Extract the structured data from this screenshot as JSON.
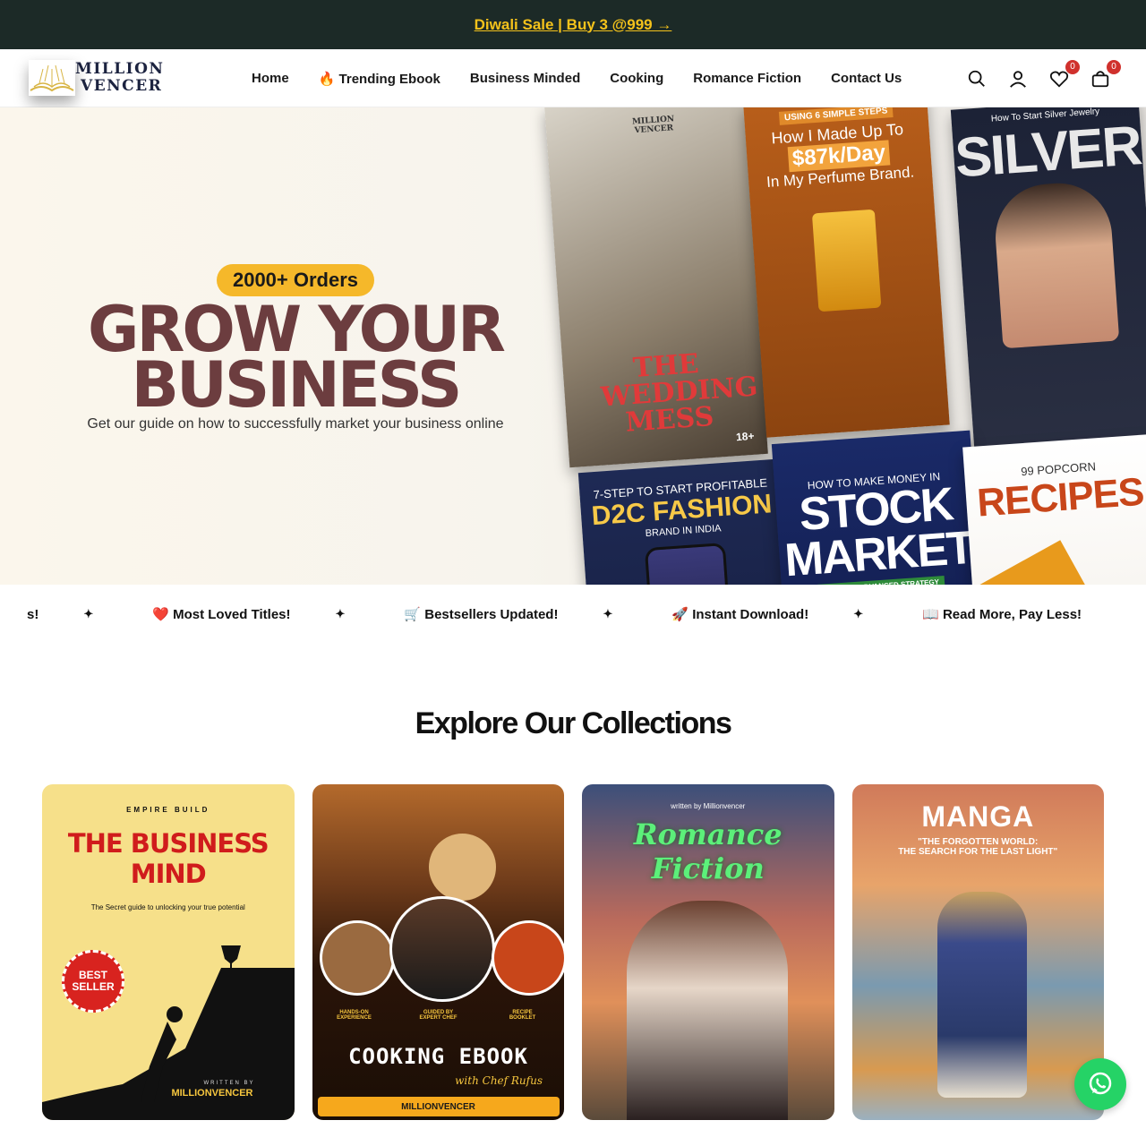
{
  "announcement": {
    "text": "Diwali Sale | Buy 3 @999 →"
  },
  "logo": {
    "line1": "MILLION",
    "line2": "VENCER"
  },
  "nav": {
    "home": "Home",
    "trending": "🔥 Trending Ebook",
    "business": "Business Minded",
    "cooking": "Cooking",
    "romance": "Romance Fiction",
    "contact": "Contact Us"
  },
  "header_icons": {
    "wishlist_count": "0",
    "cart_count": "0"
  },
  "hero": {
    "badge": "2000+ Orders",
    "headline_line1": "GROW YOUR",
    "headline_line2": "BUSINESS",
    "subline": "Get our guide on how to successfully market your business online",
    "books": [
      {
        "title": "THE WEDDING MESS",
        "brand": "MILLION VENCER",
        "age": "18+"
      },
      {
        "kicker": "USING 6 SIMPLE STEPS",
        "title_a": "How I Made Up To",
        "title_b": "$87k/Day",
        "title_c": "In My Perfume Brand."
      },
      {
        "kicker": "How To Start Silver Jewelry",
        "title": "SILVER"
      },
      {
        "kicker": "7-STEP TO START PROFITABLE",
        "title": "D2C FASHION",
        "sub": "BRAND IN INDIA"
      },
      {
        "kicker": "HOW TO MAKE MONEY IN",
        "title_a": "STOCK",
        "title_b": "MARKET",
        "sub": "BASIC TO ADVANCED STRATEGY"
      },
      {
        "kicker": "99 POPCORN",
        "title": "RECIPES"
      }
    ]
  },
  "ticker": [
    "s!",
    "❤️ Most Loved Titles!",
    "🛒 Bestsellers Updated!",
    "🚀 Instant Download!",
    "📖 Read More, Pay Less!"
  ],
  "collections": {
    "title": "Explore Our Collections",
    "cards": [
      {
        "kicker": "EMPIRE BUILD",
        "title": "THE BUSINESS MIND",
        "sub": "The Secret guide to unlocking your true potential",
        "badge": "BEST SELLER",
        "author_label": "WRITTEN BY",
        "author": "MILLIONVENCER"
      },
      {
        "tags": [
          "HANDS-ON EXPERIENCE",
          "GUIDED BY EXPERT CHEF",
          "RECIPE BOOKLET"
        ],
        "title": "COOKING EBOOK",
        "sub": "with Chef Rufus",
        "brand": "MILLIONVENCER"
      },
      {
        "kicker": "written by Millionvencer",
        "title_a": "Romance",
        "title_b": "Fiction"
      },
      {
        "title": "MANGA",
        "sub_a": "\"THE FORGOTTEN WORLD:",
        "sub_b": "THE SEARCH FOR THE LAST LIGHT\""
      }
    ]
  },
  "colors": {
    "topbar": "#1c2a27",
    "accent": "#f4c21b",
    "headline": "#6c3d3f",
    "badge": "#d0312d",
    "whatsapp": "#25d366"
  }
}
